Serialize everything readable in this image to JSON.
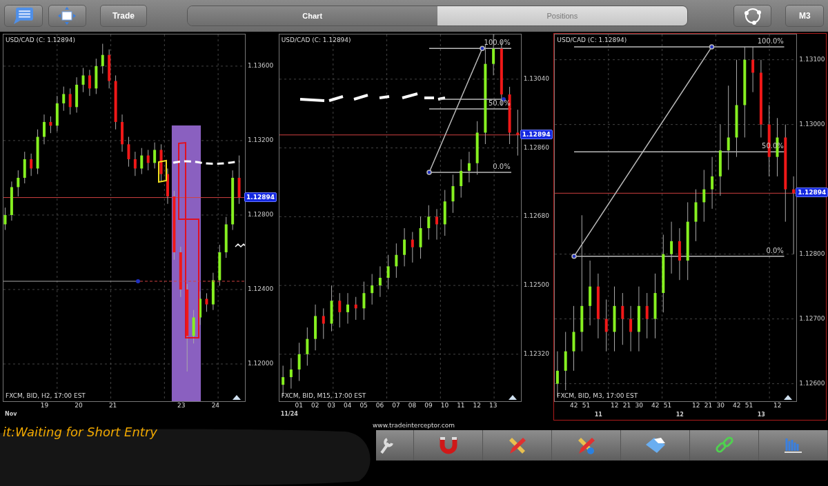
{
  "toolbar": {
    "buttons": [
      {
        "kind": "list"
      },
      {
        "kind": "move"
      },
      {
        "kind": "text",
        "label": "Trade"
      }
    ],
    "tabs": [
      {
        "label": "Chart",
        "selected": true
      },
      {
        "label": "Positions",
        "selected": false
      }
    ],
    "right_buttons": [
      {
        "kind": "connect"
      },
      {
        "kind": "text",
        "label": "M3"
      }
    ]
  },
  "charts": [
    {
      "title": "USD/CAD (C: 1.12894)",
      "selected": false,
      "info": "FXCM, BID, H2, 17:00 EST",
      "xsub": [
        "Nov"
      ],
      "chart_data": {
        "type": "candlestick",
        "x": [
          17.85,
          18.04,
          18.23,
          18.42,
          18.61,
          18.8,
          18.99,
          19.18,
          19.37,
          19.56,
          19.75,
          19.94,
          20.13,
          20.32,
          20.51,
          20.7,
          20.89,
          21.08,
          21.27,
          21.46,
          21.65,
          21.84,
          22.03,
          22.22,
          22.41,
          22.6,
          22.79,
          22.98,
          23.17,
          23.36,
          23.55,
          23.74,
          23.93,
          24.12,
          24.31,
          24.5,
          24.69
        ],
        "xlim": [
          17.8,
          24.86
        ],
        "ylim": [
          1.118,
          1.1377
        ],
        "grid": true,
        "ref_lines": [
          {
            "axis": "y",
            "value": 1.12894,
            "label": "1.12894"
          }
        ],
        "bands": [
          {
            "axis": "x",
            "from": 22.72,
            "to": 23.57,
            "color": "#8a60c0"
          }
        ],
        "xticks": [
          19,
          20,
          21,
          23,
          24
        ],
        "yticks": [
          {
            "value": 1.136,
            "label": "1.13600"
          },
          {
            "value": 1.132,
            "label": "1.13200"
          },
          {
            "value": 1.128,
            "label": "1.12800"
          },
          {
            "value": 1.124,
            "label": "1.12400"
          },
          {
            "value": 1.12,
            "label": "1.12000"
          }
        ],
        "ohlc": [
          [
            1.1275,
            1.1284,
            1.1272,
            1.128
          ],
          [
            1.128,
            1.1298,
            1.1277,
            1.1295
          ],
          [
            1.1295,
            1.1304,
            1.129,
            1.13
          ],
          [
            1.13,
            1.1314,
            1.1297,
            1.131
          ],
          [
            1.131,
            1.1313,
            1.1301,
            1.1305
          ],
          [
            1.1305,
            1.1326,
            1.1302,
            1.1322
          ],
          [
            1.1322,
            1.1334,
            1.1318,
            1.133
          ],
          [
            1.133,
            1.1333,
            1.1324,
            1.1328
          ],
          [
            1.1328,
            1.1344,
            1.1325,
            1.134
          ],
          [
            1.134,
            1.1349,
            1.1336,
            1.1345
          ],
          [
            1.1345,
            1.1348,
            1.1334,
            1.1338
          ],
          [
            1.1338,
            1.1354,
            1.1335,
            1.135
          ],
          [
            1.135,
            1.1359,
            1.1346,
            1.1355
          ],
          [
            1.1355,
            1.1358,
            1.1344,
            1.1348
          ],
          [
            1.1348,
            1.1364,
            1.1345,
            1.136
          ],
          [
            1.136,
            1.1372,
            1.1356,
            1.1366
          ],
          [
            1.1366,
            1.1369,
            1.1348,
            1.1352
          ],
          [
            1.1352,
            1.1355,
            1.1326,
            1.133
          ],
          [
            1.133,
            1.1334,
            1.1314,
            1.1318
          ],
          [
            1.1318,
            1.1322,
            1.1306,
            1.131
          ],
          [
            1.131,
            1.1314,
            1.1301,
            1.1305
          ],
          [
            1.1305,
            1.1316,
            1.1302,
            1.1312
          ],
          [
            1.1312,
            1.1315,
            1.1304,
            1.1308
          ],
          [
            1.1308,
            1.1319,
            1.1305,
            1.1315
          ],
          [
            1.1315,
            1.1318,
            1.1298,
            1.1302
          ],
          [
            1.1302,
            1.1305,
            1.1286,
            1.129
          ],
          [
            1.129,
            1.1293,
            1.1256,
            1.126
          ],
          [
            1.126,
            1.1263,
            1.1236,
            1.124
          ],
          [
            1.124,
            1.1243,
            1.1196,
            1.1215
          ],
          [
            1.1215,
            1.1229,
            1.1211,
            1.1225
          ],
          [
            1.1225,
            1.1239,
            1.1221,
            1.1235
          ],
          [
            1.1235,
            1.1238,
            1.1228,
            1.1232
          ],
          [
            1.1232,
            1.1249,
            1.1229,
            1.1245
          ],
          [
            1.1245,
            1.1264,
            1.1242,
            1.126
          ],
          [
            1.126,
            1.1279,
            1.1257,
            1.1275
          ],
          [
            1.1275,
            1.1304,
            1.1272,
            1.13
          ],
          [
            1.13,
            1.1312,
            1.1286,
            1.12894
          ]
        ]
      }
    },
    {
      "title": "USD/CAD (C: 1.12894)",
      "selected": false,
      "info": "FXCM, BID, M15, 17:00 EST",
      "xsub": [
        "11/24"
      ],
      "chart_data": {
        "type": "candlestick",
        "x": [
          0,
          0.5,
          1,
          1.5,
          2,
          2.5,
          3,
          3.5,
          4,
          4.5,
          5,
          5.5,
          6,
          6.5,
          7,
          7.5,
          8,
          8.5,
          9,
          9.5,
          10,
          10.5,
          11,
          11.5,
          12,
          12.5,
          13,
          13.5,
          14,
          14.5
        ],
        "xlim": [
          -0.22,
          14.7
        ],
        "ylim": [
          1.12197,
          1.13157
        ],
        "grid": true,
        "xticks": [
          {
            "value": 1,
            "label": "01"
          },
          {
            "value": 2,
            "label": "02"
          },
          {
            "value": 3,
            "label": "03"
          },
          {
            "value": 4,
            "label": "04"
          },
          {
            "value": 5,
            "label": "05"
          },
          {
            "value": 6,
            "label": "06"
          },
          {
            "value": 7,
            "label": "07"
          },
          {
            "value": 8,
            "label": "08"
          },
          {
            "value": 9,
            "label": "09"
          },
          {
            "value": 10,
            "label": "10"
          },
          {
            "value": 11,
            "label": "11"
          },
          {
            "value": 12,
            "label": "12"
          },
          {
            "value": 13,
            "label": "13"
          }
        ],
        "yticks": [
          {
            "value": 1.1304,
            "label": "1.13040"
          },
          {
            "value": 1.1286,
            "label": "1.12860"
          },
          {
            "value": 1.1268,
            "label": "1.12680"
          },
          {
            "value": 1.125,
            "label": "1.12500"
          },
          {
            "value": 1.1232,
            "label": "1.12320"
          }
        ],
        "ref_lines": [
          {
            "axis": "y",
            "value": 1.12894,
            "label": "1.12894"
          }
        ],
        "annotations": [
          "100.0%",
          "50.0%",
          "0.0%"
        ],
        "ohlc": [
          [
            1.1224,
            1.1229,
            1.1221,
            1.1226
          ],
          [
            1.1226,
            1.1231,
            1.1223,
            1.1228
          ],
          [
            1.1228,
            1.1235,
            1.1225,
            1.1232
          ],
          [
            1.1232,
            1.1239,
            1.1229,
            1.1236
          ],
          [
            1.1236,
            1.1245,
            1.1233,
            1.1242
          ],
          [
            1.1242,
            1.1244,
            1.1236,
            1.124
          ],
          [
            1.124,
            1.125,
            1.1238,
            1.1246
          ],
          [
            1.1246,
            1.1248,
            1.1239,
            1.1243
          ],
          [
            1.1243,
            1.1248,
            1.124,
            1.1245
          ],
          [
            1.1245,
            1.1247,
            1.1241,
            1.1244
          ],
          [
            1.1244,
            1.1251,
            1.1241,
            1.1248
          ],
          [
            1.1248,
            1.1253,
            1.1245,
            1.125
          ],
          [
            1.125,
            1.1255,
            1.1247,
            1.1252
          ],
          [
            1.1252,
            1.1258,
            1.1249,
            1.1255
          ],
          [
            1.1255,
            1.1261,
            1.1252,
            1.1258
          ],
          [
            1.1258,
            1.1265,
            1.1255,
            1.1262
          ],
          [
            1.1262,
            1.1264,
            1.1256,
            1.126
          ],
          [
            1.126,
            1.1268,
            1.1257,
            1.1265
          ],
          [
            1.1265,
            1.1271,
            1.1262,
            1.1268
          ],
          [
            1.1268,
            1.127,
            1.1262,
            1.1266
          ],
          [
            1.1266,
            1.1275,
            1.1263,
            1.1272
          ],
          [
            1.1272,
            1.1279,
            1.1269,
            1.1276
          ],
          [
            1.1276,
            1.1283,
            1.1273,
            1.128
          ],
          [
            1.128,
            1.1285,
            1.1277,
            1.1282
          ],
          [
            1.1282,
            1.1293,
            1.1279,
            1.129
          ],
          [
            1.129,
            1.1313,
            1.1287,
            1.1308
          ],
          [
            1.1308,
            1.1316,
            1.1305,
            1.1312
          ],
          [
            1.1312,
            1.1314,
            1.1297,
            1.13
          ],
          [
            1.13,
            1.1302,
            1.1287,
            1.129
          ],
          [
            1.129,
            1.1296,
            1.1284,
            1.12894
          ]
        ]
      }
    },
    {
      "title": "USD/CAD (C: 1.12894)",
      "selected": true,
      "info": "FXCM, BID, M3, 17:00 EST",
      "minute_labels": [
        "42",
        "51",
        "12",
        "21",
        "30",
        "42",
        "51",
        "12",
        "21",
        "30",
        "42",
        "51",
        "12"
      ],
      "chart_data": {
        "type": "candlestick",
        "x": [
          10.5,
          10.6,
          10.7,
          10.8,
          10.9,
          11,
          11.1,
          11.2,
          11.3,
          11.4,
          11.5,
          11.6,
          11.7,
          11.8,
          11.9,
          12,
          12.1,
          12.2,
          12.3,
          12.4,
          12.5,
          12.6,
          12.7,
          12.8,
          12.9,
          13,
          13.1,
          13.2,
          13.3,
          13.4
        ],
        "xlim": [
          10.467,
          13.433
        ],
        "ylim": [
          1.12573,
          1.13139
        ],
        "grid": true,
        "xticks": [
          11,
          12,
          13
        ],
        "yticks": [
          {
            "value": 1.131,
            "label": "1.13100"
          },
          {
            "value": 1.13,
            "label": "1.13000"
          },
          {
            "value": 1.128,
            "label": "1.12800"
          },
          {
            "value": 1.127,
            "label": "1.12700"
          },
          {
            "value": 1.126,
            "label": "1.12600"
          }
        ],
        "ref_lines": [
          {
            "axis": "y",
            "value": 1.12894,
            "label": "1.12894"
          }
        ],
        "annotations": [
          "100.0%",
          "50.0%",
          "0.0%"
        ],
        "ohlc": [
          [
            1.126,
            1.1265,
            1.1258,
            1.1262
          ],
          [
            1.1262,
            1.1268,
            1.1259,
            1.1265
          ],
          [
            1.1265,
            1.1272,
            1.1262,
            1.1268
          ],
          [
            1.1268,
            1.1286,
            1.1265,
            1.1272
          ],
          [
            1.1272,
            1.1279,
            1.1269,
            1.1275
          ],
          [
            1.1275,
            1.1277,
            1.1267,
            1.127
          ],
          [
            1.127,
            1.1273,
            1.1265,
            1.1268
          ],
          [
            1.1268,
            1.1275,
            1.1265,
            1.1272
          ],
          [
            1.1272,
            1.1274,
            1.1266,
            1.127
          ],
          [
            1.127,
            1.1272,
            1.1265,
            1.1268
          ],
          [
            1.1268,
            1.1275,
            1.1265,
            1.1272
          ],
          [
            1.1272,
            1.1274,
            1.1267,
            1.127
          ],
          [
            1.127,
            1.1277,
            1.1267,
            1.1274
          ],
          [
            1.1274,
            1.1283,
            1.1271,
            1.128
          ],
          [
            1.128,
            1.1285,
            1.1277,
            1.1282
          ],
          [
            1.1282,
            1.1284,
            1.1276,
            1.1279
          ],
          [
            1.1279,
            1.1288,
            1.1276,
            1.1285
          ],
          [
            1.1285,
            1.129,
            1.1282,
            1.1288
          ],
          [
            1.1288,
            1.1293,
            1.1285,
            1.129
          ],
          [
            1.129,
            1.1295,
            1.1287,
            1.1292
          ],
          [
            1.1292,
            1.13,
            1.1289,
            1.1296
          ],
          [
            1.1296,
            1.1306,
            1.1293,
            1.1298
          ],
          [
            1.1298,
            1.131,
            1.1295,
            1.1303
          ],
          [
            1.1303,
            1.1312,
            1.1298,
            1.131
          ],
          [
            1.131,
            1.1312,
            1.1305,
            1.1308
          ],
          [
            1.1308,
            1.131,
            1.1298,
            1.13
          ],
          [
            1.13,
            1.1303,
            1.1292,
            1.1295
          ],
          [
            1.1295,
            1.1301,
            1.1292,
            1.1298
          ],
          [
            1.1298,
            1.13,
            1.1285,
            1.129
          ],
          [
            1.129,
            1.1292,
            1.128,
            1.12894
          ]
        ]
      }
    }
  ],
  "website": "www.tradeinterceptor.com",
  "note": "it:Waiting for Short Entry",
  "tools": [
    {
      "kind": "wrench"
    },
    {
      "kind": "magnet"
    },
    {
      "kind": "ruler-pencil"
    },
    {
      "kind": "ruler-pencil-info"
    },
    {
      "kind": "folder"
    },
    {
      "kind": "link"
    },
    {
      "kind": "chart"
    }
  ]
}
